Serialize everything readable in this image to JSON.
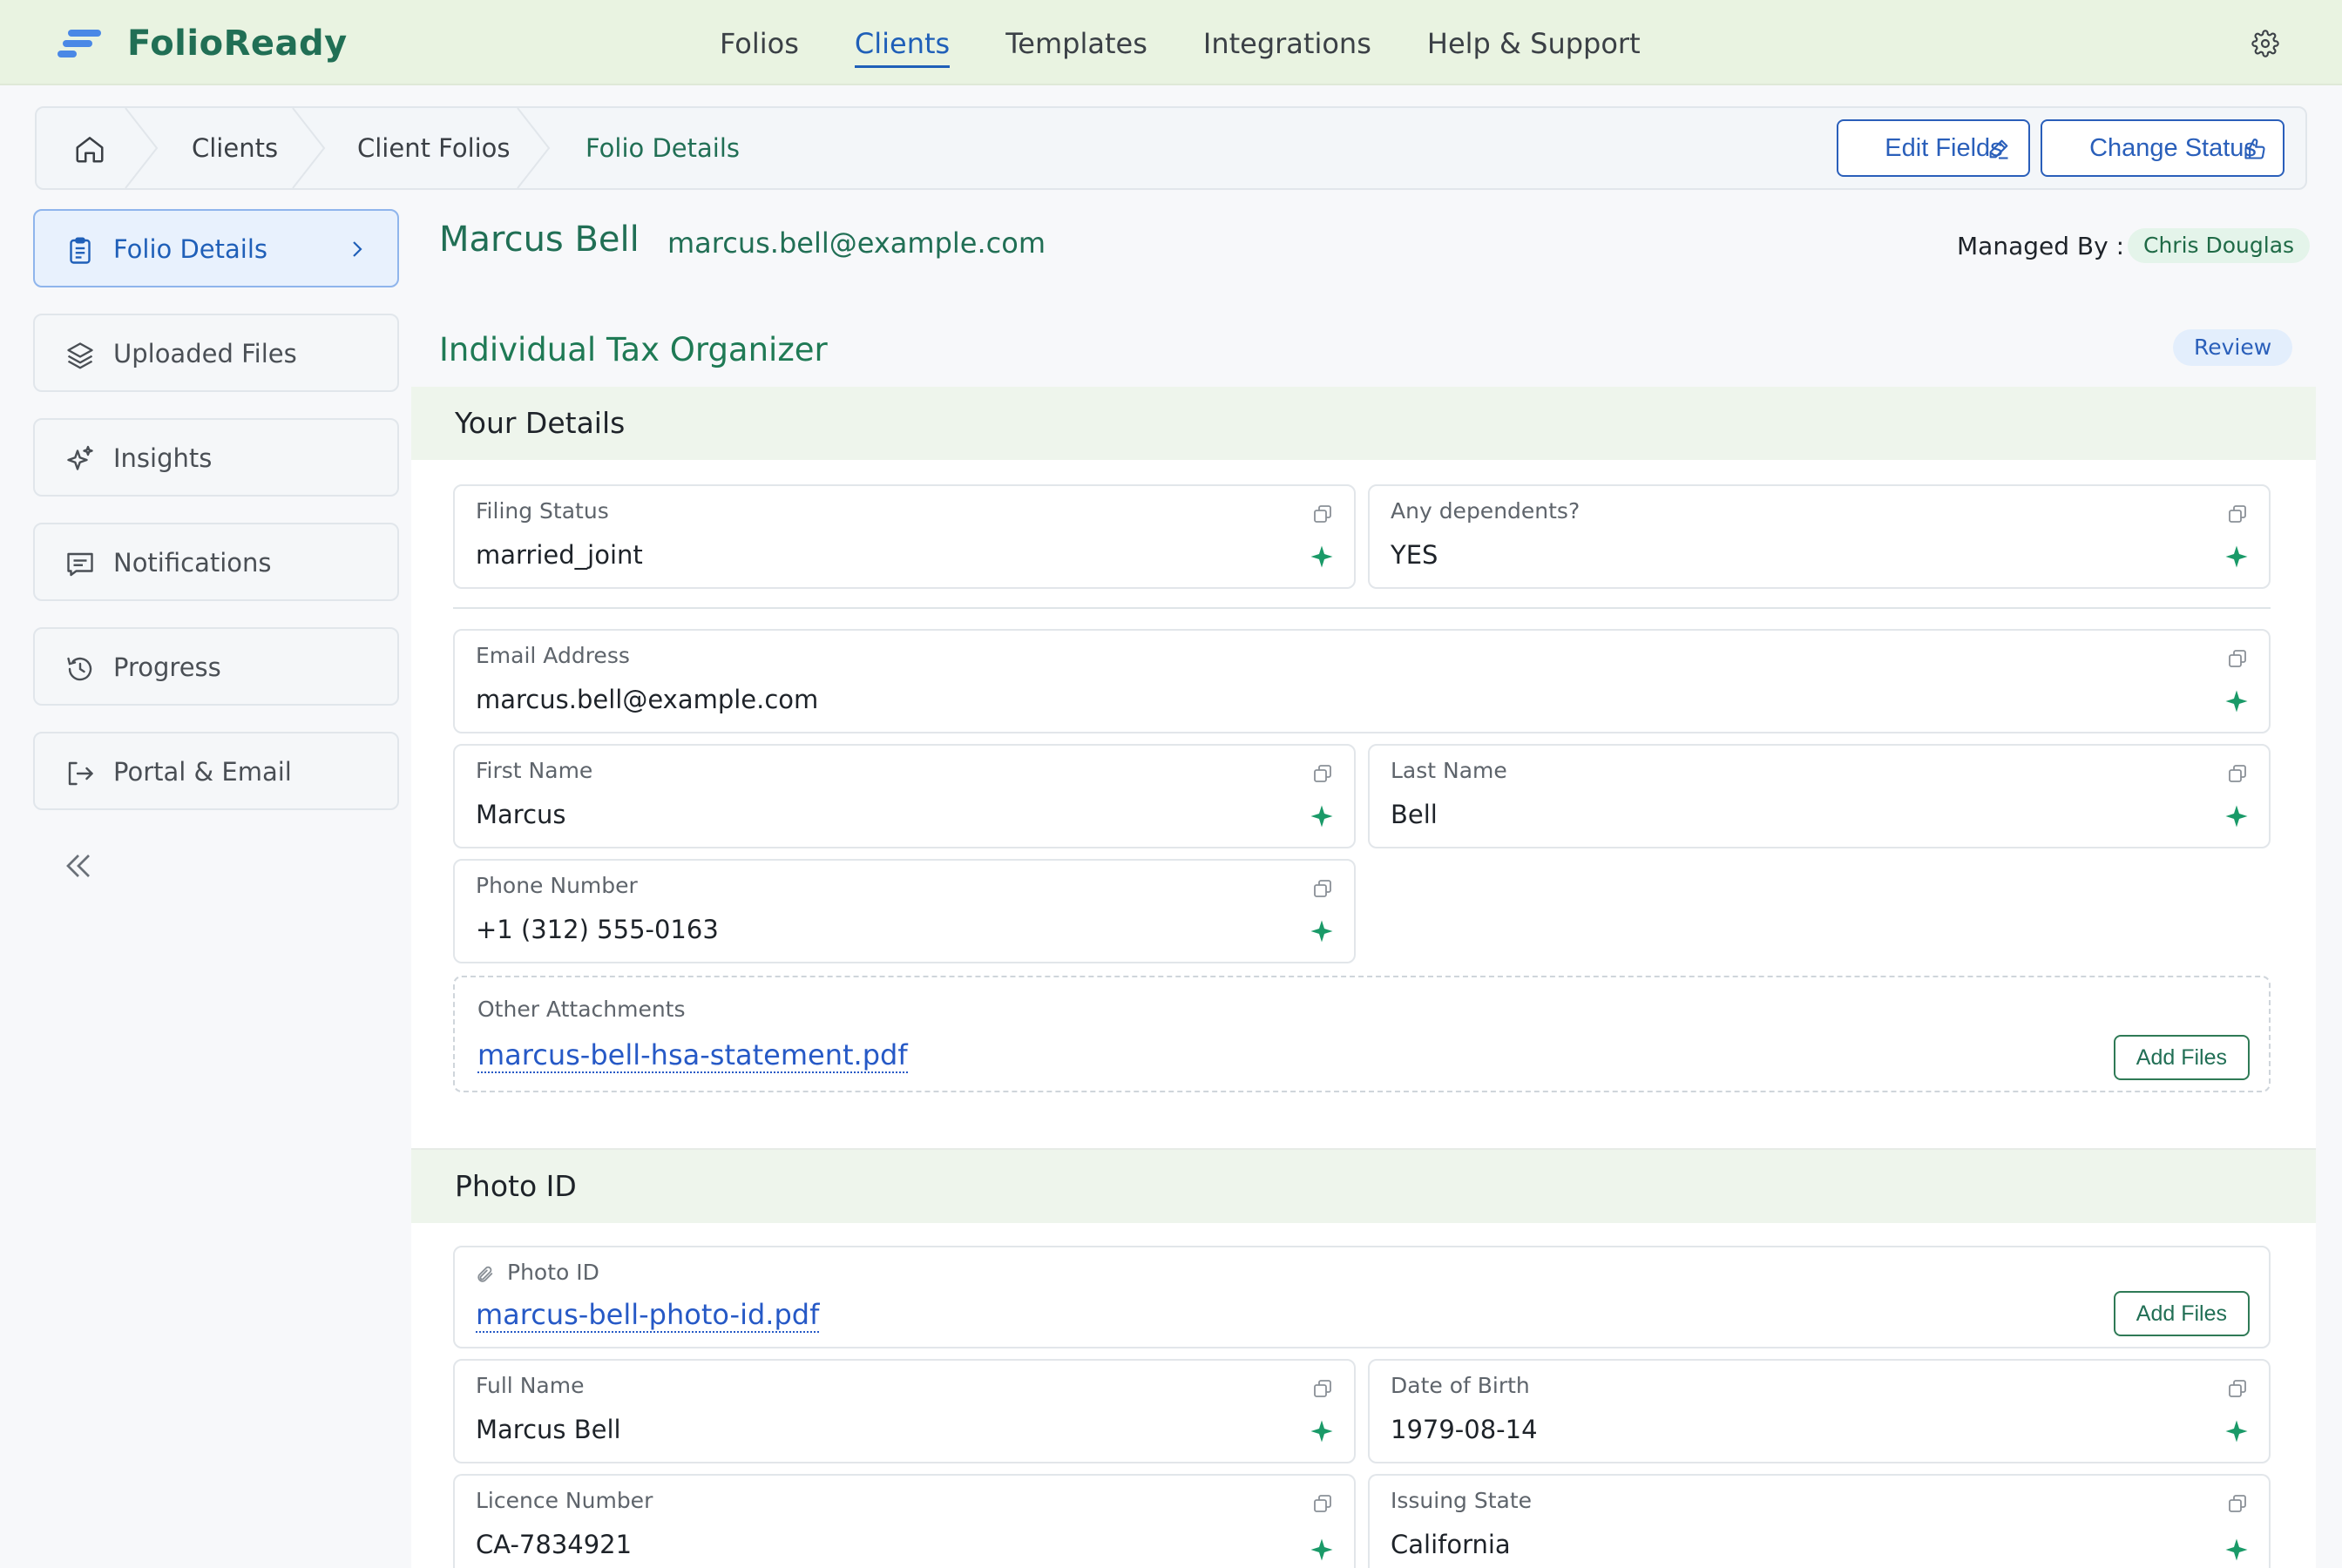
{
  "app": {
    "name": "FolioReady"
  },
  "nav": {
    "items": [
      {
        "label": "Folios"
      },
      {
        "label": "Clients"
      },
      {
        "label": "Templates"
      },
      {
        "label": "Integrations"
      },
      {
        "label": "Help & Support"
      }
    ],
    "active": "Clients"
  },
  "breadcrumb": {
    "items": [
      {
        "label": "Clients"
      },
      {
        "label": "Client Folios"
      },
      {
        "label": "Folio Details"
      }
    ]
  },
  "actions": {
    "edit_fields": "Edit Fields",
    "change_status": "Change Status"
  },
  "sidebar": {
    "items": [
      {
        "label": "Folio Details",
        "icon": "clipboard-icon"
      },
      {
        "label": "Uploaded Files",
        "icon": "layers-icon"
      },
      {
        "label": "Insights",
        "icon": "sparkle-icon"
      },
      {
        "label": "Notifications",
        "icon": "message-icon"
      },
      {
        "label": "Progress",
        "icon": "history-icon"
      },
      {
        "label": "Portal & Email",
        "icon": "logout-icon"
      }
    ]
  },
  "client": {
    "name": "Marcus Bell",
    "email": "marcus.bell@example.com",
    "managed_by_label": "Managed By :",
    "manager": "Chris Douglas"
  },
  "form": {
    "title": "Individual Tax Organizer",
    "status": "Review"
  },
  "your_details": {
    "title": "Your Details",
    "filing_status": {
      "label": "Filing Status",
      "value": "married_joint"
    },
    "dependents": {
      "label": "Any dependents?",
      "value": "YES"
    },
    "email": {
      "label": "Email Address",
      "value": "marcus.bell@example.com"
    },
    "first_name": {
      "label": "First Name",
      "value": "Marcus"
    },
    "last_name": {
      "label": "Last Name",
      "value": "Bell"
    },
    "phone": {
      "label": "Phone Number",
      "value": "+1 (312) 555-0163"
    },
    "attachments": {
      "label": "Other Attachments",
      "file": "marcus-bell-hsa-statement.pdf",
      "button": "Add Files"
    }
  },
  "photo_id": {
    "title": "Photo ID",
    "file_field": {
      "label": "Photo ID",
      "file": "marcus-bell-photo-id.pdf",
      "button": "Add Files"
    },
    "full_name": {
      "label": "Full Name",
      "value": "Marcus Bell"
    },
    "dob": {
      "label": "Date of Birth",
      "value": "1979-08-14"
    },
    "licence": {
      "label": "Licence Number",
      "value": "CA-7834921"
    },
    "state": {
      "label": "Issuing State",
      "value": "California"
    }
  },
  "colors": {
    "brand_green": "#216f55",
    "accent_blue": "#1f5fb8",
    "topbar_bg": "#e9f3e1",
    "spark_green": "#1a9a68"
  }
}
